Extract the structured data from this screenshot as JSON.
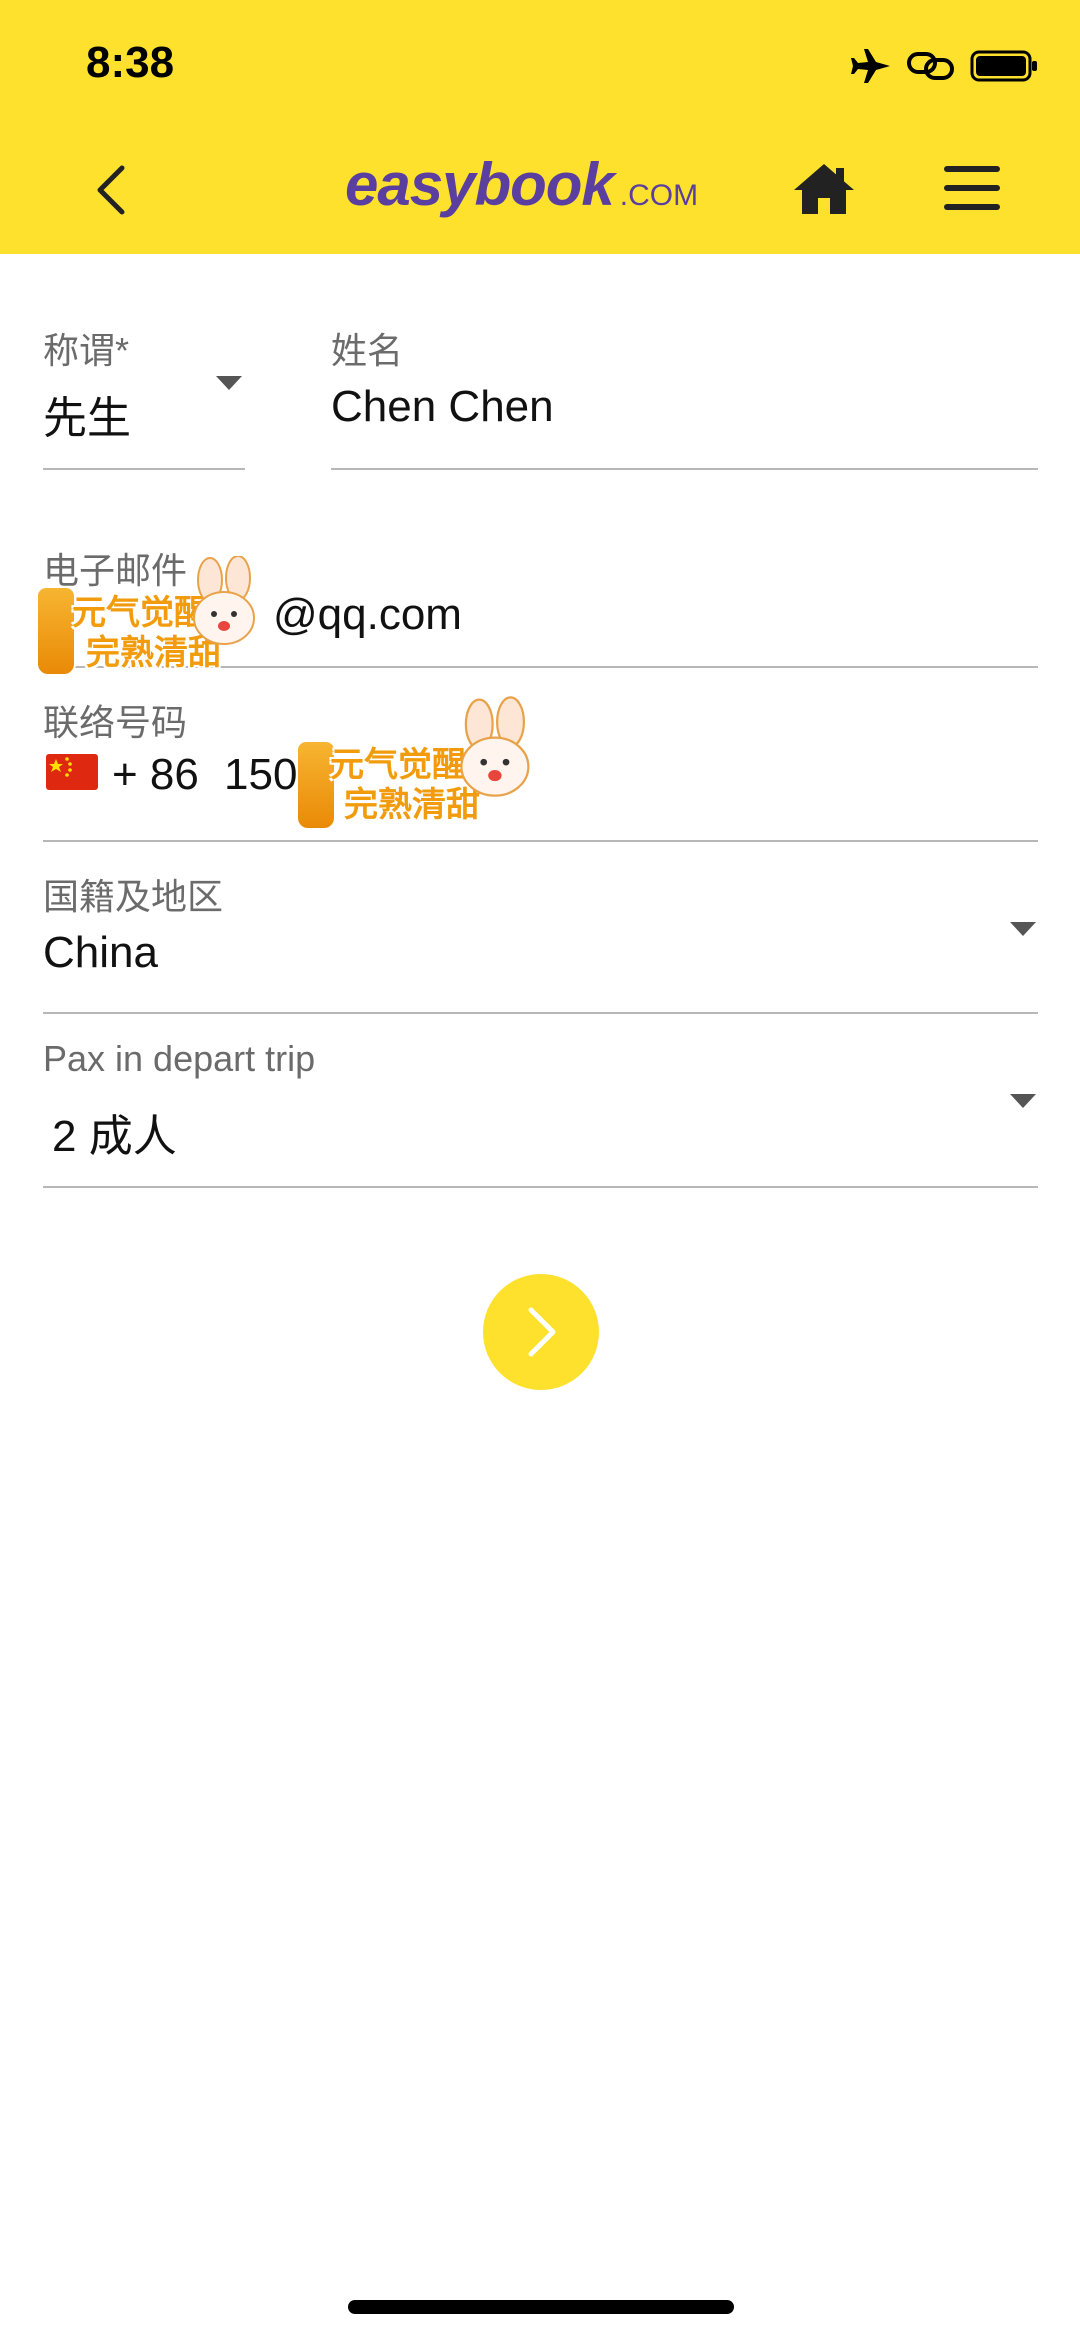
{
  "status_bar": {
    "time": "8:38",
    "icons": [
      "airplane-icon",
      "link-icon",
      "battery-icon"
    ]
  },
  "header": {
    "logo_main": "easybook",
    "logo_suffix": ".COM",
    "background_color": "#fde12d",
    "logo_color": "#5b3fa0"
  },
  "form": {
    "title_label": "称谓*",
    "title_value": "先生",
    "name_label": "姓名",
    "name_value": "Chen Chen",
    "email_label": "电子邮件",
    "email_value": "@qq.com",
    "phone_label": "联络号码",
    "phone_code": "+ 86",
    "phone_value": "150",
    "nationality_label": "国籍及地区",
    "nationality_value": "China",
    "pax_label": "Pax in depart trip",
    "pax_value": "2 成人"
  },
  "stickers": {
    "text_1": "元气觉醒",
    "text_2": "完熟清甜"
  }
}
